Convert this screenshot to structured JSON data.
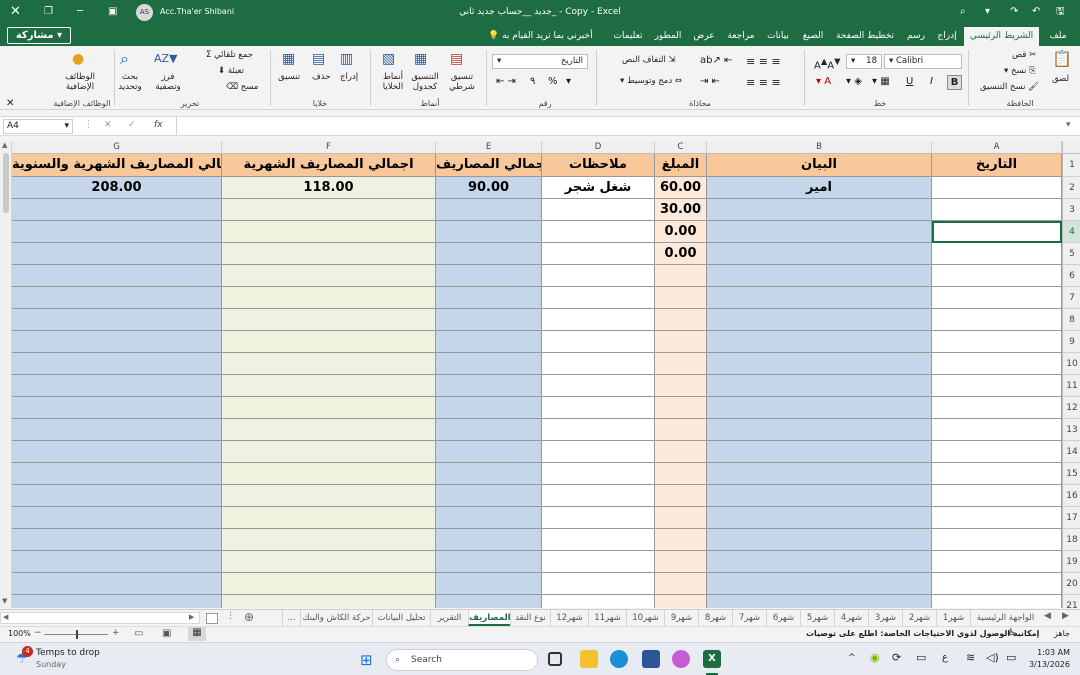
{
  "titlebar": {
    "title": "جديد __حساب جديد ثاني_ - Copy - Excel",
    "user": "Acc.Tha'er Shibani",
    "avatar": "AS"
  },
  "tabs": [
    "ملف",
    "الشريط الرئيسي",
    "إدراج",
    "رسم",
    "تخطيط الصفحة",
    "الصيغ",
    "بيانات",
    "مراجعة",
    "عرض",
    "المطور",
    "تعليمات"
  ],
  "tell_me": "أخبرني بما تريد القيام به",
  "share": "مشاركة",
  "ribbon": {
    "clipboard": {
      "paste": "لصق",
      "cut": "قص",
      "copy": "نسخ",
      "format_painter": "نسخ التنسيق",
      "name": "الحافظة"
    },
    "font": {
      "font": "Calibri",
      "size": "18",
      "bold": "B",
      "italic": "I",
      "underline": "U",
      "name": "خط"
    },
    "alignment": {
      "wrap": "التفاف النص",
      "merge": "دمج وتوسيط",
      "name": "محاذاة"
    },
    "number": {
      "format": "التاريخ",
      "percent": "%",
      "comma": "٩",
      "name": "رقم"
    },
    "styles": {
      "conditional": "تنسيق شرطي",
      "table": "التنسيق كجدول",
      "cell_styles": "أنماط الخلايا",
      "name": "أنماط"
    },
    "cells": {
      "insert": "إدراج",
      "delete": "حذف",
      "format": "تنسيق",
      "name": "خلايا"
    },
    "editing": {
      "autosum": "جمع تلقائي",
      "fill": "تعبئة",
      "clear": "مسح",
      "sort": "فرز وتصفية",
      "find": "بحث وتحديد",
      "name": "تحرير"
    },
    "addins": {
      "label": "الوظائف الإضافية",
      "name": "الوظائف الإضافية"
    }
  },
  "formula_bar": {
    "name_box": "A4",
    "fx": "fx",
    "value": ""
  },
  "columns": [
    "A",
    "B",
    "C",
    "D",
    "E",
    "F",
    "G"
  ],
  "rows": [
    "1",
    "2",
    "3",
    "4",
    "5",
    "6",
    "7",
    "8",
    "9",
    "10",
    "11",
    "12",
    "13",
    "14",
    "15",
    "16",
    "17",
    "18",
    "19",
    "20",
    "21"
  ],
  "headers": {
    "A": "التاريخ",
    "B": "البيان",
    "C": "المبلغ",
    "D": "ملاحظات",
    "E": "اجمالي المصاريف",
    "F": "اجمالي المصاريف الشهرية",
    "G": "اجمالي المصاريف الشهرية والسنوية"
  },
  "row2": {
    "B": "امير",
    "C": "60.00",
    "D": "شغل شجر",
    "E": "90.00",
    "F": "118.00",
    "G": "208.00"
  },
  "c_values": {
    "r3": "30.00",
    "r4": "0.00",
    "r5": "0.00"
  },
  "sheets": [
    "الواجهة الرئيسية",
    "شهر1",
    "شهر2",
    "شهر3",
    "شهر4",
    "شهر5",
    "شهر6",
    "شهر7",
    "شهر8",
    "شهر9",
    "شهر10",
    "شهر11",
    "شهر12",
    "نوع النقد",
    "المصاريف",
    "التقرير",
    "تحليل البيانات",
    "حركة الكاش والبنك",
    "..."
  ],
  "active_sheet": "المصاريف",
  "status": {
    "ready": "جاهز",
    "accessibility": "إمكانية الوصول لذوي الاحتياجات الخاصة: اطلع على توصيات",
    "zoom": "100%"
  },
  "taskbar": {
    "weather": "Temps to drop",
    "weather_sub": "Sunday",
    "weather_badge": "4",
    "search": "Search",
    "time": "1:03 AM",
    "date": "3/13/2026",
    "lang": "ع"
  },
  "colors": {
    "excel_green": "#1e6c41",
    "header_orange": "#f8c89b",
    "blue": "#c5d5ea",
    "green": "#eef3df",
    "orange_light": "#fde9d9"
  }
}
